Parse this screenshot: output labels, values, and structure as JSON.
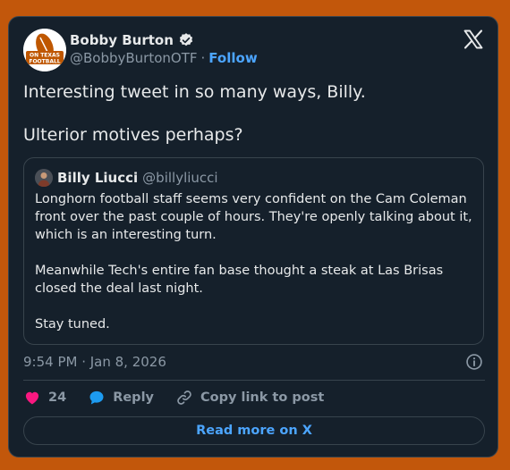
{
  "author": {
    "name": "Bobby Burton",
    "handle": "@BobbyBurtonOTF",
    "follow_label": "Follow",
    "separator": "·",
    "verified": true,
    "avatar_text": {
      "line1": "ON TEXAS",
      "line2": "FOOTBALL"
    }
  },
  "tweet": {
    "paragraphs": [
      "Interesting tweet in so many ways, Billy.",
      "Ulterior motives perhaps?"
    ],
    "timestamp": "9:54 PM · Jan 8, 2026"
  },
  "quote": {
    "name": "Billy Liucci",
    "handle": "@billyliucci",
    "paragraphs": [
      "Longhorn football staff seems very confident on the Cam Coleman front over the past couple of hours. They're openly talking about it, which is an interesting turn.",
      "Meanwhile Tech's entire fan base thought a steak at Las Brisas closed the deal last night.",
      "Stay tuned."
    ]
  },
  "actions": {
    "like_count": "24",
    "reply_label": "Reply",
    "copy_label": "Copy link to post"
  },
  "read_more_label": "Read more on X",
  "colors": {
    "page_background": "#c2570b",
    "card_background": "#15202b",
    "border": "#38444d",
    "accent": "#4ca5ff",
    "like": "#f91880",
    "reply": "#1d9bf0"
  },
  "icons": [
    "verified-badge-icon",
    "x-logo-icon",
    "info-icon",
    "heart-icon",
    "reply-bubble-icon",
    "link-icon"
  ]
}
